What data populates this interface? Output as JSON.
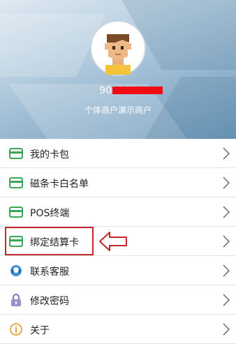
{
  "profile": {
    "account_number": "900102",
    "merchant_name": "个体商户演示商户"
  },
  "menu": {
    "items": [
      {
        "label": "我的卡包",
        "icon": "card-icon"
      },
      {
        "label": "磁条卡白名单",
        "icon": "card-icon"
      },
      {
        "label": "POS终端",
        "icon": "card-icon"
      },
      {
        "label": "绑定结算卡",
        "icon": "card-icon"
      },
      {
        "label": "联系客服",
        "icon": "headset-icon"
      },
      {
        "label": "修改密码",
        "icon": "lock-icon"
      },
      {
        "label": "关于",
        "icon": "info-icon"
      }
    ]
  },
  "colors": {
    "card_green": "#3aa657",
    "highlight_red": "#c0282d",
    "redaction_red": "#f00c12"
  }
}
